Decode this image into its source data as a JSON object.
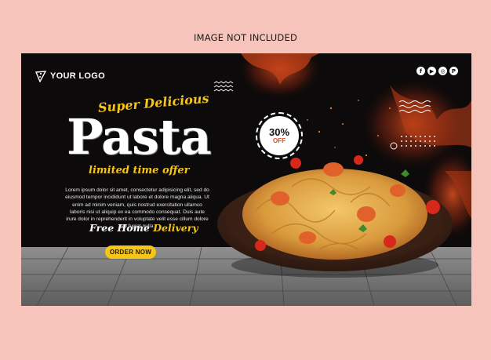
{
  "top_note": "IMAGE NOT INCLUDED",
  "brand": {
    "logo_text": "YOUR LOGO"
  },
  "social": [
    {
      "icon": "facebook-icon",
      "glyph": "f"
    },
    {
      "icon": "youtube-icon",
      "glyph": "▶"
    },
    {
      "icon": "instagram-icon",
      "glyph": "◎"
    },
    {
      "icon": "pinterest-icon",
      "glyph": "P"
    }
  ],
  "hero": {
    "tagline": "Super Delicious",
    "title": "Pasta",
    "offer": "limited time offer",
    "body": "Lorem ipsum dolor sit amet, consectetur adipisicing elit, sed do eiusmod tempor incididunt ut labore et dolore magna aliqua. Ut enim ad minim veniam, quis nostrud exercitation ullamco laboris nisi ut aliquip ex ea commodo consequat. Duis aute irure dolor in reprehenderit in voluptate velit esse cillum dolore eu fugiat nulla",
    "delivery_prefix": "Free Home",
    "delivery_highlight": "Delivery",
    "cta": "ORDER NOW"
  },
  "badge": {
    "percent": "30%",
    "label": "OFF"
  },
  "colors": {
    "accent": "#f5c518",
    "background": "#0c0a0a",
    "page": "#f6c4bb",
    "fire": "#d2451c"
  }
}
